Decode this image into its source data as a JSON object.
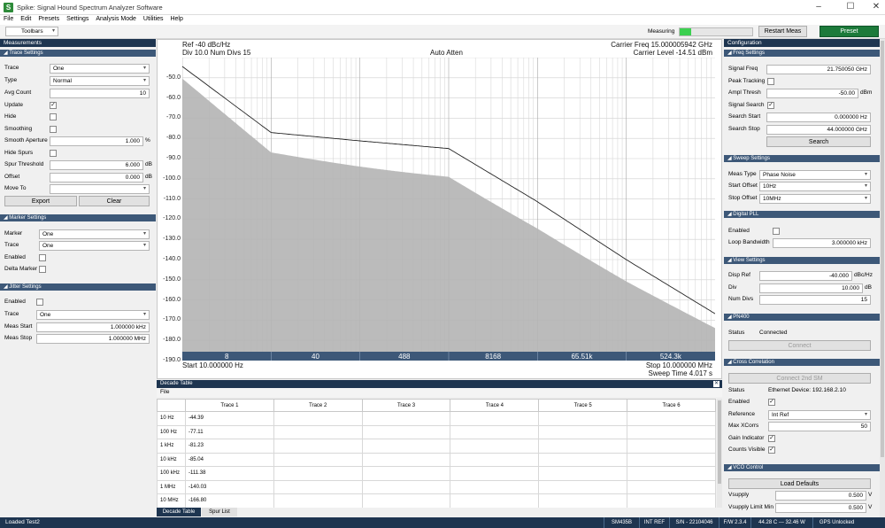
{
  "app": {
    "title": "Spike: Signal Hound Spectrum Analyzer Software"
  },
  "menu": [
    "File",
    "Edit",
    "Presets",
    "Settings",
    "Analysis Mode",
    "Utilities",
    "Help"
  ],
  "toolbar": {
    "toolbars_label": "Toolbars",
    "measuring_label": "Measuring",
    "restart_label": "Restart Meas",
    "preset_label": "Preset"
  },
  "left": {
    "header": "Measurements",
    "trace_settings": {
      "title": "Trace Settings",
      "trace_label": "Trace",
      "trace_value": "One",
      "type_label": "Type",
      "type_value": "Normal",
      "avg_label": "Avg Count",
      "avg_value": "10",
      "update_label": "Update",
      "hide_label": "Hide",
      "smoothing_label": "Smoothing",
      "aperture_label": "Smooth Aperture",
      "aperture_value": "1.000",
      "aperture_unit": "%",
      "hidespurs_label": "Hide Spurs",
      "spur_label": "Spur Threshold",
      "spur_value": "6.000",
      "spur_unit": "dB",
      "offset_label": "Offset",
      "offset_value": "0.000",
      "offset_unit": "dB",
      "moveto_label": "Move To",
      "export_label": "Export",
      "clear_label": "Clear"
    },
    "marker_settings": {
      "title": "Marker Settings",
      "marker_label": "Marker",
      "marker_value": "One",
      "trace_label": "Trace",
      "trace_value": "One",
      "enabled_label": "Enabled",
      "delta_label": "Delta Marker"
    },
    "jitter_settings": {
      "title": "Jitter Settings",
      "enabled_label": "Enabled",
      "trace_label": "Trace",
      "trace_value": "One",
      "start_label": "Meas Start",
      "start_value": "1.000000 kHz",
      "stop_label": "Meas Stop",
      "stop_value": "1.000000 MHz"
    }
  },
  "plot": {
    "ref": "Ref -40 dBc/Hz",
    "div": "Div 10.0 Num Divs 15",
    "atten": "Auto Atten",
    "carrier_freq": "Carrier Freq 15.000005942 GHz",
    "carrier_level": "Carrier Level -14.51 dBm",
    "start": "Start 10.000000 Hz",
    "stop": "Stop 10.000000 MHz",
    "sweep": "Sweep Time 4.017 s",
    "y_labels": [
      "-50.0",
      "-60.0",
      "-70.0",
      "-80.0",
      "-90.0",
      "-100.0",
      "-110.0",
      "-120.0",
      "-130.0",
      "-140.0",
      "-150.0",
      "-160.0",
      "-170.0",
      "-180.0",
      "-190.0"
    ],
    "x_labels": [
      "8",
      "40",
      "488",
      "8168",
      "65.51k",
      "524.3k"
    ]
  },
  "decade_table": {
    "title": "Decade Table",
    "file": "File",
    "columns": [
      "Trace 1",
      "Trace 2",
      "Trace 3",
      "Trace 4",
      "Trace 5",
      "Trace 6"
    ],
    "rows": [
      {
        "freq": "10 Hz",
        "t1": "-44.39"
      },
      {
        "freq": "100 Hz",
        "t1": "-77.11"
      },
      {
        "freq": "1 kHz",
        "t1": "-81.23"
      },
      {
        "freq": "10 kHz",
        "t1": "-85.04"
      },
      {
        "freq": "100 kHz",
        "t1": "-111.38"
      },
      {
        "freq": "1 MHz",
        "t1": "-140.03"
      },
      {
        "freq": "10 MHz",
        "t1": "-166.80"
      }
    ],
    "tabs": [
      "Decade Table",
      "Spur List"
    ]
  },
  "right": {
    "header": "Configuration",
    "freq": {
      "title": "Freq Settings",
      "signal_freq_label": "Signal Freq",
      "signal_freq_value": "21.750050 GHz",
      "peak_label": "Peak Tracking",
      "ampl_label": "Ampl Thresh",
      "ampl_value": "-50.00",
      "ampl_unit": "dBm",
      "search_label": "Signal Search",
      "sstart_label": "Search Start",
      "sstart_value": "0.000000 Hz",
      "sstop_label": "Search Stop",
      "sstop_value": "44.000000 GHz",
      "search_btn": "Search"
    },
    "sweep": {
      "title": "Sweep Settings",
      "type_label": "Meas Type",
      "type_value": "Phase Noise",
      "start_label": "Start Offset",
      "start_value": "10Hz",
      "stop_label": "Stop Offset",
      "stop_value": "10MHz"
    },
    "pll": {
      "title": "Digital PLL",
      "enabled_label": "Enabled",
      "loop_label": "Loop Bandwidth",
      "loop_value": "3.000000 kHz"
    },
    "view": {
      "title": "View Settings",
      "ref_label": "Disp Ref",
      "ref_value": "-40.000",
      "ref_unit": "dBc/Hz",
      "div_label": "Div",
      "div_value": "10.000",
      "div_unit": "dB",
      "num_label": "Num Divs",
      "num_value": "15"
    },
    "pn400": {
      "title": "PN400",
      "status_label": "Status",
      "status_value": "Connected",
      "connect_btn": "Connect"
    },
    "xcorr": {
      "title": "Cross Correlation",
      "connect_btn": "Connect 2nd SM",
      "status_label": "Status",
      "status_value": "Ethernet Device: 192.168.2.10",
      "enabled_label": "Enabled",
      "ref_label": "Reference",
      "ref_value": "Int Ref",
      "max_label": "Max XCorrs",
      "max_value": "50",
      "gain_label": "Gain Indicator",
      "counts_label": "Counts Visible"
    },
    "vco": {
      "title": "VCO Control",
      "load_btn": "Load Defaults",
      "vsupply_label": "Vsupply",
      "vsupply_value": "0.500",
      "vsupply_unit": "V",
      "vlimit_label": "Vsupply Limit Min",
      "vlimit_value": "0.500",
      "vlimit_unit": "V"
    }
  },
  "status": {
    "loaded": "Loaded Test2",
    "model": "SM435B",
    "ref": "INT REF",
    "sn": "S/N - 22104046",
    "fw": "F/W 2.3.4",
    "temp": "44.28 C --- 32.46 W",
    "gps": "GPS Unlocked"
  },
  "chart_data": {
    "type": "area",
    "x_scale": "log",
    "x": [
      10,
      100,
      1000,
      10000,
      100000,
      1000000,
      10000000
    ],
    "series": [
      {
        "name": "Trace 1",
        "values": [
          -44.39,
          -77.11,
          -81.23,
          -85.04,
          -111.38,
          -140.03,
          -166.8
        ]
      }
    ],
    "ylim": [
      -190,
      -40
    ]
  }
}
